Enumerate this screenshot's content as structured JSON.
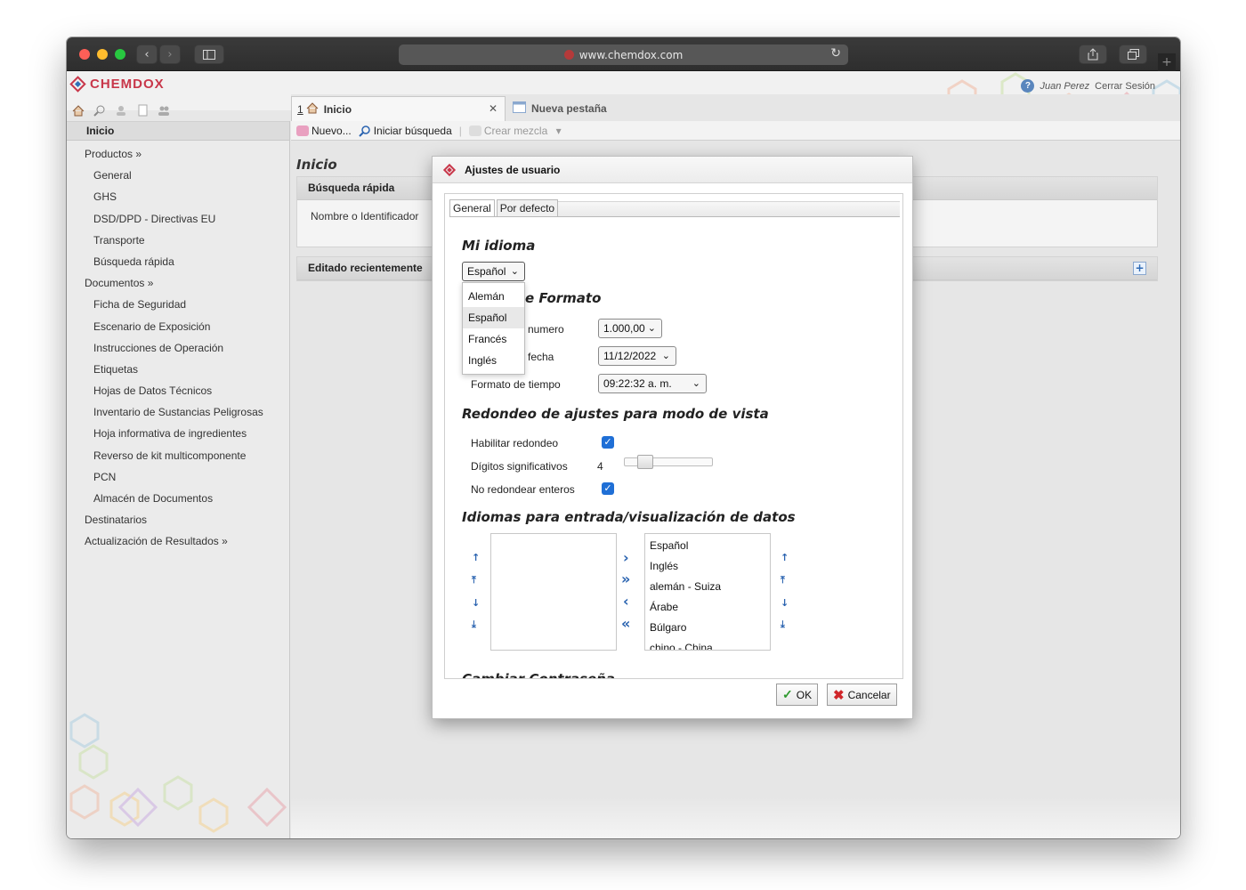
{
  "browser": {
    "url": "www.chemdox.com",
    "reload_icon": "reload-icon",
    "back_icon": "chevron-left-icon",
    "forward_icon": "chevron-right-icon"
  },
  "app": {
    "logo_text": "CHEMDOX",
    "user_name": "Juan Perez",
    "logout": "Cerrar Sesión",
    "help_glyph": "?"
  },
  "sidebar": {
    "title": "Inicio",
    "items": [
      {
        "label": "Productos »",
        "level": 1
      },
      {
        "label": "General",
        "level": 2
      },
      {
        "label": "GHS",
        "level": 2
      },
      {
        "label": "DSD/DPD - Directivas EU",
        "level": 2
      },
      {
        "label": "Transporte",
        "level": 2
      },
      {
        "label": "Búsqueda rápida",
        "level": 2
      },
      {
        "label": "Documentos »",
        "level": 1
      },
      {
        "label": "Ficha de Seguridad",
        "level": 2
      },
      {
        "label": "Escenario de Exposición",
        "level": 2
      },
      {
        "label": "Instrucciones de Operación",
        "level": 2
      },
      {
        "label": "Etiquetas",
        "level": 2
      },
      {
        "label": "Hojas de Datos Técnicos",
        "level": 2
      },
      {
        "label": "Inventario de Sustancias Peligrosas",
        "level": 2
      },
      {
        "label": "Hoja informativa de ingredientes",
        "level": 2
      },
      {
        "label": "Reverso de kit multicomponente",
        "level": 2
      },
      {
        "label": "PCN",
        "level": 2
      },
      {
        "label": "Almacén de Documentos",
        "level": 2
      },
      {
        "label": "Destinatarios",
        "level": 1
      },
      {
        "label": "Actualización de Resultados »",
        "level": 1
      }
    ]
  },
  "tabs": {
    "active_num": "1",
    "active_label": "Inicio",
    "close_glyph": "✕",
    "new_tab_label": "Nueva pestaña"
  },
  "toolbar": {
    "new_label": "Nuevo...",
    "search_label": "Iniciar búsqueda",
    "mix_label": "Crear mezcla",
    "mix_caret": "▾"
  },
  "content": {
    "title": "Inicio",
    "quick_search_header": "Búsqueda rápida",
    "quick_search_field_label": "Nombre o Identificador",
    "recent_header": "Editado recientemente",
    "add_glyph": "+"
  },
  "dialog": {
    "title": "Ajustes de usuario",
    "tab_general": "General",
    "tab_default": "Por defecto",
    "section_language": "Mi idioma",
    "language_selected": "Español",
    "language_options": [
      "Alemán",
      "Español",
      "Francés",
      "Inglés"
    ],
    "section_format_tail": "e Formato",
    "number_label_tail": "numero",
    "number_value": "1.000,00",
    "date_label_tail": "fecha",
    "date_value": "11/12/2022",
    "time_label": "Formato de tiempo",
    "time_value": "09:22:32 a. m.",
    "section_rounding": "Redondeo de ajustes para modo de vista",
    "enable_rounding_label": "Habilitar redondeo",
    "enable_rounding_checked": true,
    "significant_digits_label": "Dígitos significativos",
    "significant_digits_value": "4",
    "no_round_integers_label": "No redondear enteros",
    "no_round_integers_checked": true,
    "section_data_languages": "Idiomas para entrada/visualización de datos",
    "available_languages": [],
    "selected_languages": [
      "Español",
      "Inglés",
      "alemán - Suiza",
      "Árabe",
      "Búlgaro",
      "chino - China"
    ],
    "section_password_partial": "Cambiar Contraseña",
    "ok_label": "OK",
    "cancel_label": "Cancelar",
    "check_glyph": "✓"
  },
  "colors": {
    "brand": "#c8374a",
    "accent_blue": "#1f6fd6"
  }
}
